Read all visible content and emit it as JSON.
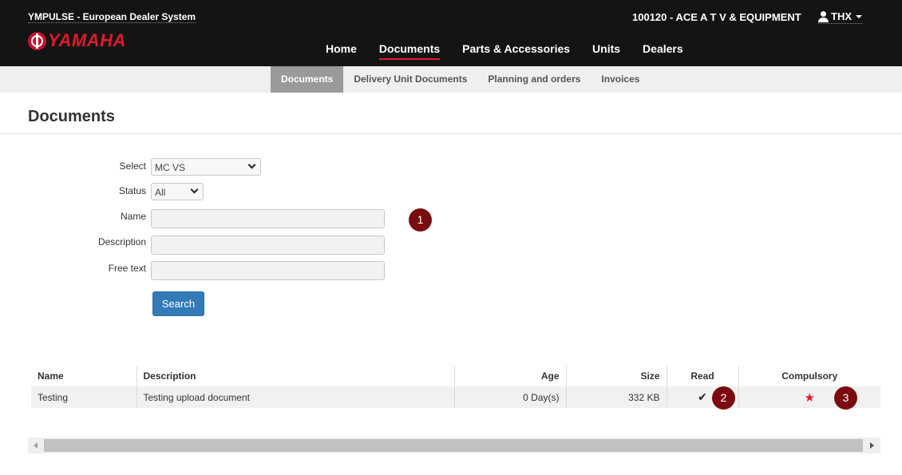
{
  "header": {
    "app_title": "YMPULSE - European Dealer System",
    "logo_text": "YAMAHA",
    "dealer": "100120 - ACE A T V & EQUIPMENT",
    "user": "THX"
  },
  "main_nav": [
    "Home",
    "Documents",
    "Parts & Accessories",
    "Units",
    "Dealers"
  ],
  "main_nav_active": "Documents",
  "sub_nav": [
    "Documents",
    "Delivery Unit Documents",
    "Planning and orders",
    "Invoices"
  ],
  "sub_nav_active": "Documents",
  "page": {
    "title": "Documents"
  },
  "form": {
    "select_label": "Select",
    "select_value": "MC VS",
    "status_label": "Status",
    "status_value": "All",
    "name_label": "Name",
    "name_value": "",
    "description_label": "Description",
    "description_value": "",
    "free_text_label": "Free text",
    "free_text_value": "",
    "search_label": "Search"
  },
  "markers": [
    "1",
    "2",
    "3"
  ],
  "table": {
    "headers": [
      "Name",
      "Description",
      "Age",
      "Size",
      "Read",
      "Compulsory"
    ],
    "rows": [
      {
        "name": "Testing",
        "description": "Testing upload document",
        "age": "0 Day(s)",
        "size": "332 KB",
        "read": "check-icon",
        "compulsory": "star-icon"
      }
    ]
  },
  "colors": {
    "header_bg": "#141414",
    "brand_red": "#e3182d",
    "primary_button": "#337ab7",
    "marker": "#7a0c10"
  }
}
